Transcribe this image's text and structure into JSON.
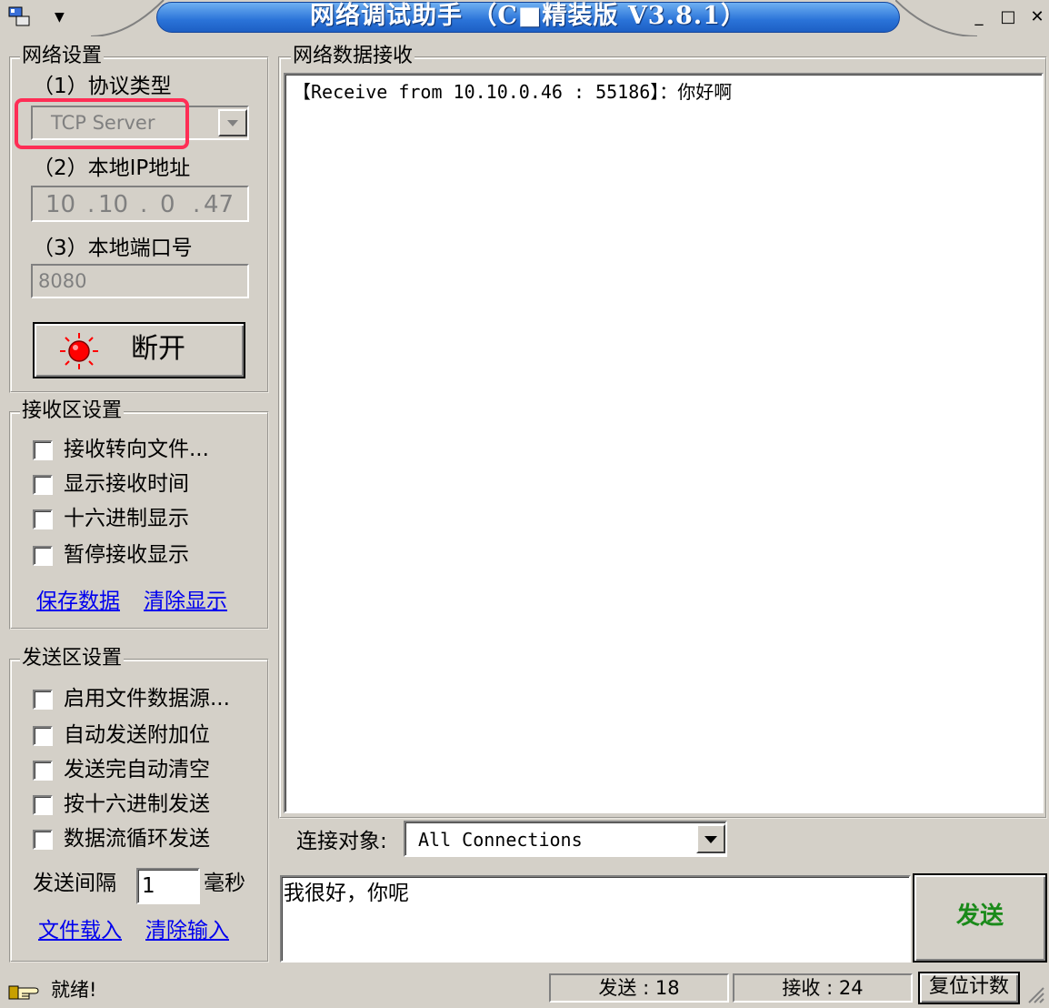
{
  "window": {
    "title": "网络调试助手 （C■精装版 V3.8.1）",
    "min_glyph": "_",
    "max_glyph": "□",
    "close_glyph": "✕"
  },
  "net_settings": {
    "legend": "网络设置",
    "protocol_label": "（1）协议类型",
    "protocol_value": "TCP Server",
    "ip_label": "（2）本地IP地址",
    "ip": [
      "10",
      "10",
      "0",
      "47"
    ],
    "port_label": "（3）本地端口号",
    "port_value": "8080",
    "connect_button": "断开"
  },
  "receive_settings": {
    "legend": "接收区设置",
    "options": [
      "接收转向文件...",
      "显示接收时间",
      "十六进制显示",
      "暂停接收显示"
    ],
    "save_link": "保存数据",
    "clear_link": "清除显示"
  },
  "send_settings": {
    "legend": "发送区设置",
    "options": [
      "启用文件数据源...",
      "自动发送附加位",
      "发送完自动清空",
      "按十六进制发送",
      "数据流循环发送"
    ],
    "interval_label": "发送间隔",
    "interval_value": "1",
    "interval_unit": "毫秒",
    "load_link": "文件载入",
    "clear_link": "清除输入"
  },
  "receive_area": {
    "legend": "网络数据接收",
    "content": "【Receive from 10.10.0.46 : 55186】：你好啊"
  },
  "target": {
    "label": "连接对象:",
    "value": "All Connections"
  },
  "send_area": {
    "text": "我很好，你呢",
    "send_button": "发送"
  },
  "status": {
    "ready": "就绪!",
    "sent": "发送 : 18",
    "received": "接收 : 24",
    "reset_button": "复位计数"
  },
  "colors": {
    "title_blue": "#2a73d8",
    "highlight_red": "#ff2d55",
    "led_red": "#ff0000",
    "send_green": "#1a8a1a",
    "link_blue": "#0000ee"
  }
}
